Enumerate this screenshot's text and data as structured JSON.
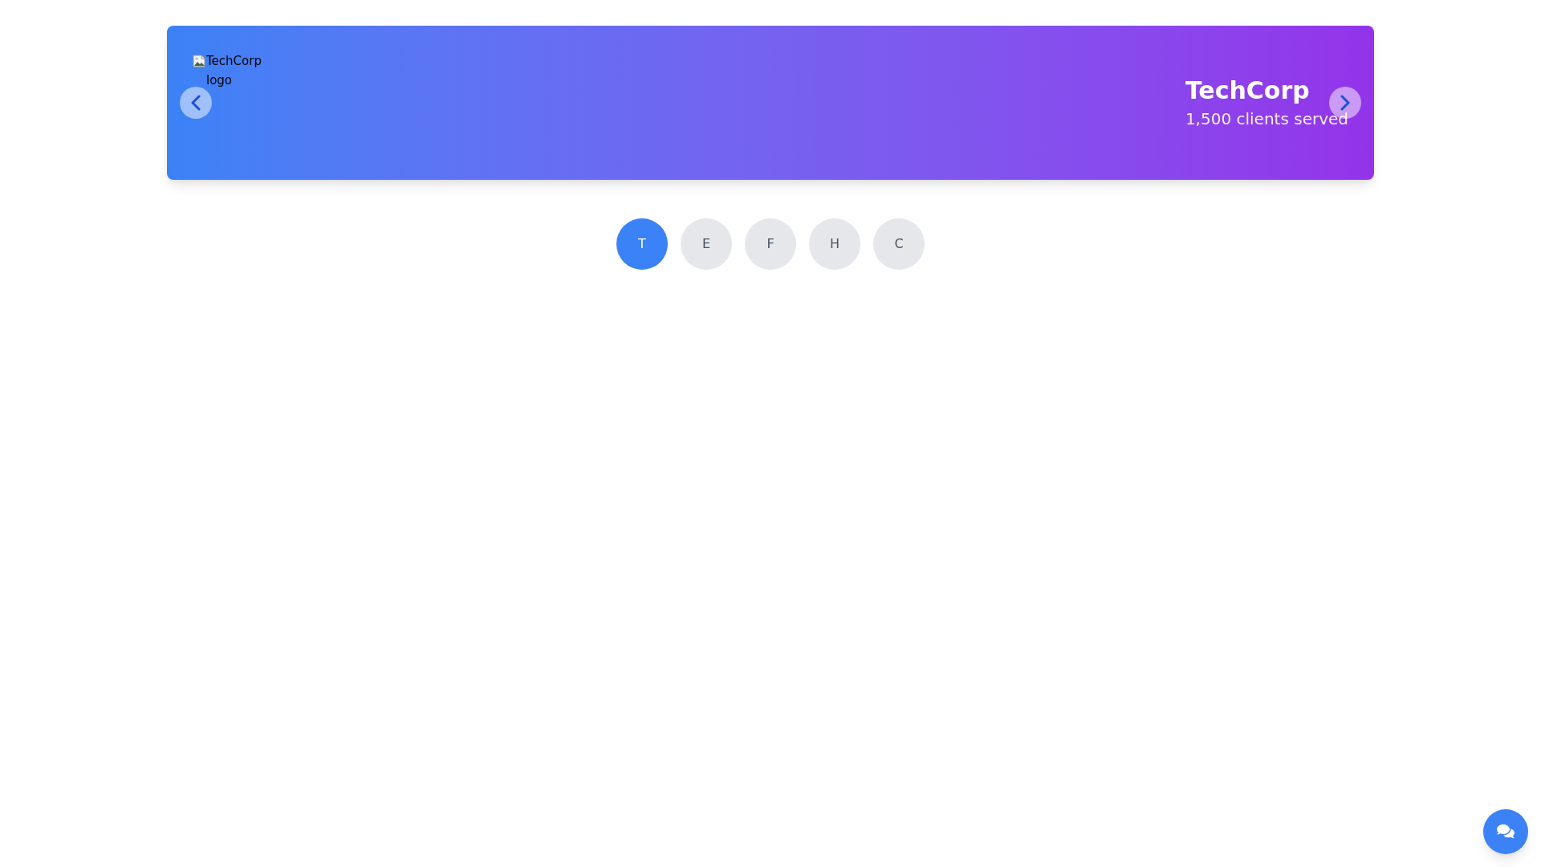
{
  "banner": {
    "logo_alt": "TechCorp logo",
    "title": "TechCorp",
    "subtitle": "1,500 clients served"
  },
  "indicators": [
    {
      "label": "T",
      "selected": true
    },
    {
      "label": "E",
      "selected": false
    },
    {
      "label": "F",
      "selected": false
    },
    {
      "label": "H",
      "selected": false
    },
    {
      "label": "C",
      "selected": false
    }
  ]
}
